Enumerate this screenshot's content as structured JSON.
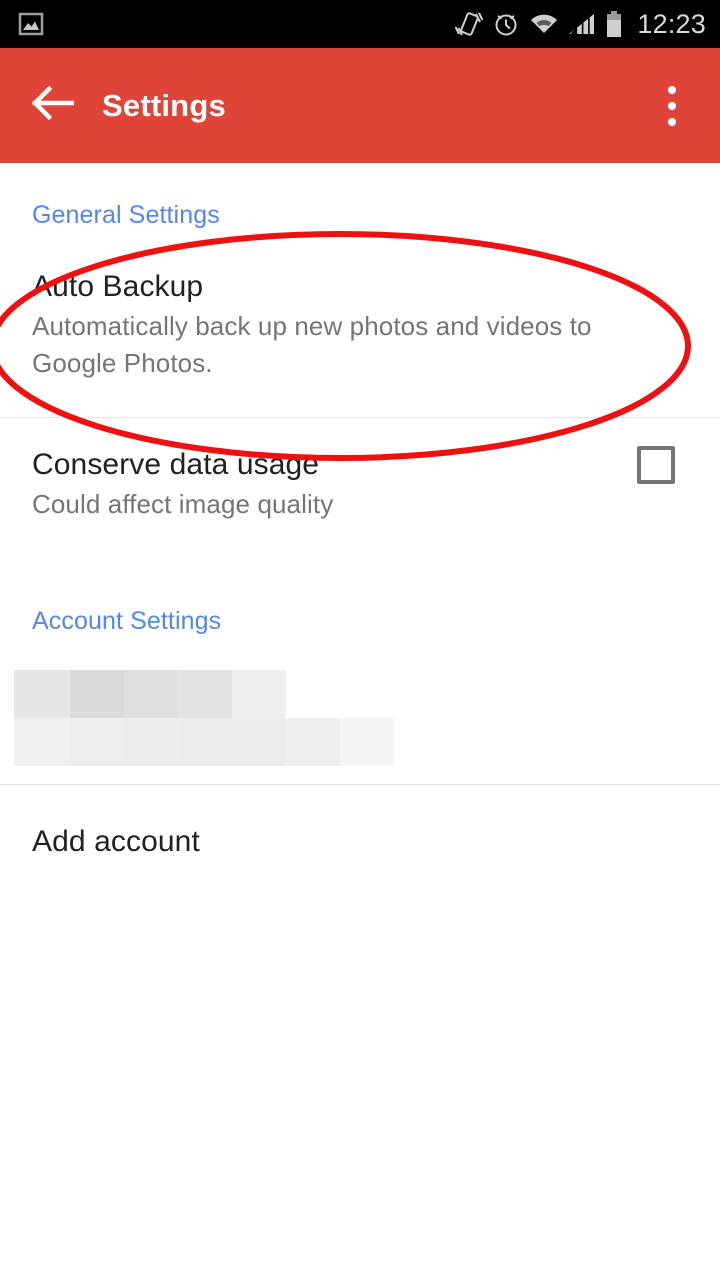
{
  "status_bar": {
    "background": "#000000",
    "clock": "12:23",
    "icons": [
      {
        "name": "gallery-photo-icon",
        "position": "left"
      },
      {
        "name": "vibrate-icon",
        "position": "right"
      },
      {
        "name": "alarm-clock-icon",
        "position": "right"
      },
      {
        "name": "wifi-icon",
        "position": "right"
      },
      {
        "name": "cellular-signal-icon",
        "position": "right"
      },
      {
        "name": "battery-icon",
        "position": "right"
      }
    ]
  },
  "app_bar": {
    "background": "#de4437",
    "title": "Settings",
    "back_icon": "arrow-left-icon",
    "overflow_icon": "more-vertical-icon"
  },
  "sections": [
    {
      "header": "General Settings",
      "items": [
        {
          "title": "Auto Backup",
          "subtitle": "Automatically back up new photos and videos to Google Photos.",
          "control": "none"
        },
        {
          "title": "Conserve data usage",
          "subtitle": "Could affect image quality",
          "control": "checkbox",
          "checked": false
        }
      ]
    },
    {
      "header": "Account Settings",
      "items": [
        {
          "title": "",
          "subtitle": "",
          "control": "redacted",
          "redacted_note": "blurred account name and email"
        },
        {
          "title": "Add account",
          "subtitle": "",
          "control": "none"
        }
      ]
    }
  ],
  "annotation": {
    "shape": "ellipse",
    "color": "#ee1111",
    "stroke_width": 6,
    "targets": "Auto Backup"
  },
  "colors": {
    "accent_red": "#de4437",
    "section_header_blue": "#5286f3",
    "primary_text": "#212121",
    "secondary_text": "#757575",
    "divider": "#e4e4e4",
    "annotation_red": "#ee1111"
  }
}
